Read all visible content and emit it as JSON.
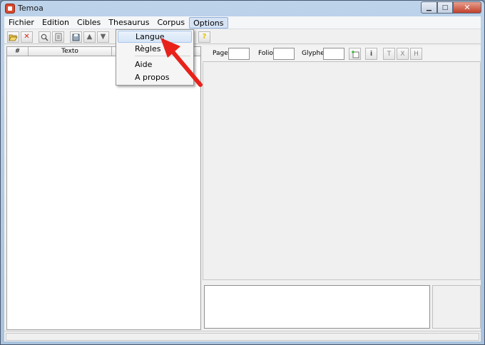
{
  "window": {
    "title": "Temoa"
  },
  "menubar": {
    "items": [
      "Fichier",
      "Edition",
      "Cibles",
      "Thesaurus",
      "Corpus",
      "Options"
    ],
    "active": "Options"
  },
  "grid": {
    "columns": [
      "#",
      "Texto"
    ]
  },
  "fields": {
    "page_label": "Page",
    "folio_label": "Folio",
    "glyphe_label": "Glyphe",
    "page_value": "",
    "folio_value": "",
    "glyphe_value": "",
    "btn_t": "T",
    "btn_x": "X",
    "btn_h": "H",
    "btn_i": "i"
  },
  "options_menu": {
    "items": [
      "Langue",
      "Règles",
      "Aide",
      "A propos"
    ],
    "highlighted": "Langue"
  },
  "colors": {
    "accent_arrow": "#e8221b",
    "menu_highlight": "#d6e5f7"
  },
  "icons": [
    "open-folder-icon",
    "delete-icon",
    "search-icon",
    "list-icon",
    "save-icon",
    "arrow-up-icon",
    "arrow-down-icon",
    "help-icon",
    "add-image-icon",
    "info-icon"
  ]
}
